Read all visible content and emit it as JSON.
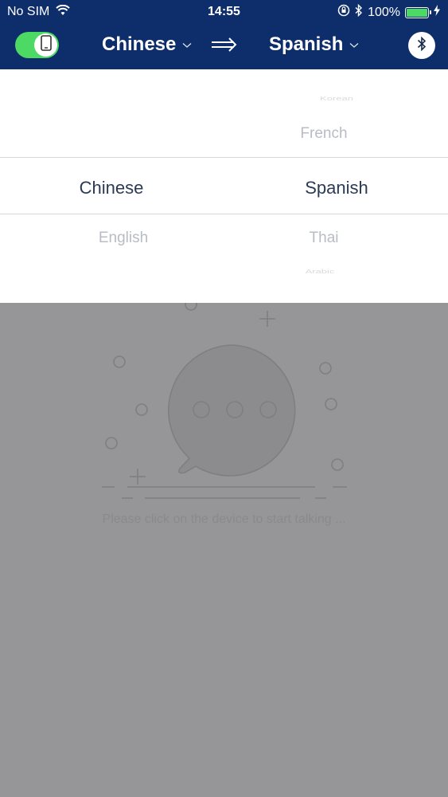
{
  "status_bar": {
    "carrier": "No SIM",
    "time": "14:55",
    "battery_percent_text": "100%",
    "battery_level": 1.0
  },
  "nav": {
    "source_language": "Chinese",
    "target_language": "Spanish",
    "toggle_on": true
  },
  "picker": {
    "left_column": {
      "selected": "Chinese",
      "below": [
        "English"
      ]
    },
    "right_column": {
      "above": [
        "Korean",
        "French"
      ],
      "selected": "Spanish",
      "below": [
        "Thai",
        "Arabic"
      ]
    }
  },
  "empty_state": {
    "hint": "Please click on the device to start talking ..."
  },
  "colors": {
    "nav_bg": "#0e2d6b",
    "toggle_on": "#4cd964",
    "overlay_bg": "#969597"
  }
}
